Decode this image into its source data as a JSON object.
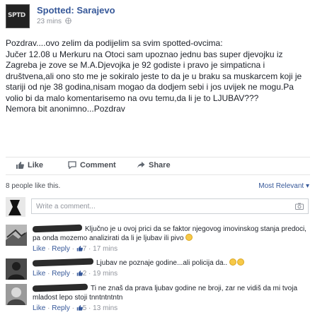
{
  "post": {
    "page_name": "Spotted: Sarajevo",
    "time": "23 mins",
    "body_lines": [
      "Pozdrav....ovo zelim da podijelim sa svim spotted-ovcima:",
      "Jučer 12.08 u Merkuru na Otoci sam upoznao jednu bas super djevojku iz Zagreba je zove se M.A.Djevojka je 92 godiste i pravo je simpaticna i društvena,ali ono sto me je sokiralo jeste to da je u braku sa muskarcem koji je stariji od nje 38 godina,nisam mogao da dodjem sebi i jos uvijek ne mogu.Pa volio bi da malo komentarisemo na ovu temu,da li je to LJUBAV???",
      "Nemora bit anonimno...Pozdrav"
    ]
  },
  "actions": {
    "like": "Like",
    "comment": "Comment",
    "share": "Share"
  },
  "likes": {
    "text_count": "8 people",
    "text_suffix": "like this."
  },
  "sort": {
    "label": "Most Relevant",
    "arrow": "▾"
  },
  "comment_input": {
    "placeholder": "Write a comment..."
  },
  "comments": [
    {
      "text": "Ključno je u ovoj prici da se faktor njegovog imovinskog stanja predoci, pa onda mozemo analizirati da li je ljubav ili pivo",
      "like": "Like",
      "reply": "Reply",
      "likes_count": "7",
      "time": "17 mins"
    },
    {
      "text": "Ljubav ne poznaje godine...ali policija da..",
      "like": "Like",
      "reply": "Reply",
      "likes_count": "2",
      "time": "19 mins"
    },
    {
      "text": "Ti ne znaš da prava ljubav godine ne broji, zar ne vidiš da mi tvoja mladost lepo stoji tnntntntntn",
      "like": "Like",
      "reply": "Reply",
      "likes_count": "5",
      "time": "13 mins"
    }
  ],
  "colors": {
    "link": "#365899",
    "muted": "#90949c",
    "text": "#1d2129"
  }
}
